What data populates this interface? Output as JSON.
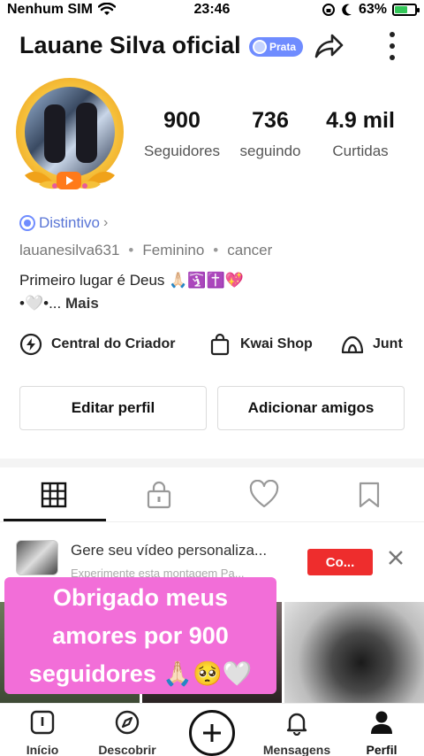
{
  "status_bar": {
    "carrier": "Nenhum SIM",
    "time": "23:46",
    "battery_percent": "63%",
    "battery_level": 0.63,
    "battery_color": "#34c759"
  },
  "header": {
    "name": "Lauane Silva oficial",
    "badge": "Prata",
    "badge_color": "#6f8cff",
    "share_icon": "share-arrow-icon",
    "more_icon": "vertical-dots-icon"
  },
  "stats": [
    {
      "value": "900",
      "label": "Seguidores"
    },
    {
      "value": "736",
      "label": "seguindo"
    },
    {
      "value": "4.9 mil",
      "label": "Curtidas"
    }
  ],
  "profile": {
    "distintivo": "Distintivo",
    "username": "lauanesilva631",
    "gender": "Feminino",
    "sign": "cancer",
    "bio_line1": "Primeiro lugar é Deus 🙏🏻🛐✝️💖",
    "bio_line2": "•🤍•...",
    "more_label": "Mais"
  },
  "tools": [
    {
      "label": "Central do Criador",
      "icon": "lightning-icon"
    },
    {
      "label": "Kwai Shop",
      "icon": "shopping-bag-icon"
    },
    {
      "label": "Junt",
      "icon": "tent-icon"
    }
  ],
  "actions": {
    "edit": "Editar perfil",
    "add_friends": "Adicionar amigos"
  },
  "tabs": [
    {
      "icon": "grid-icon",
      "active": true
    },
    {
      "icon": "lock-icon",
      "active": false
    },
    {
      "icon": "heart-icon",
      "active": false
    },
    {
      "icon": "bookmark-icon",
      "active": false
    }
  ],
  "promo": {
    "title": "Gere seu vídeo personaliza...",
    "subtitle": "Experimente esta montagem Pa...",
    "button": "Co...",
    "button_color": "#ee2d2d"
  },
  "overlay": {
    "line1": "Obrigado meus",
    "line2": "amores por 900",
    "line3": "seguidores 🙏🏻🥺🤍",
    "color": "#f26ed8"
  },
  "nav": {
    "inicio": "Início",
    "descobrir": "Descobrir",
    "mensagens": "Mensagens",
    "perfil": "Perfil"
  }
}
